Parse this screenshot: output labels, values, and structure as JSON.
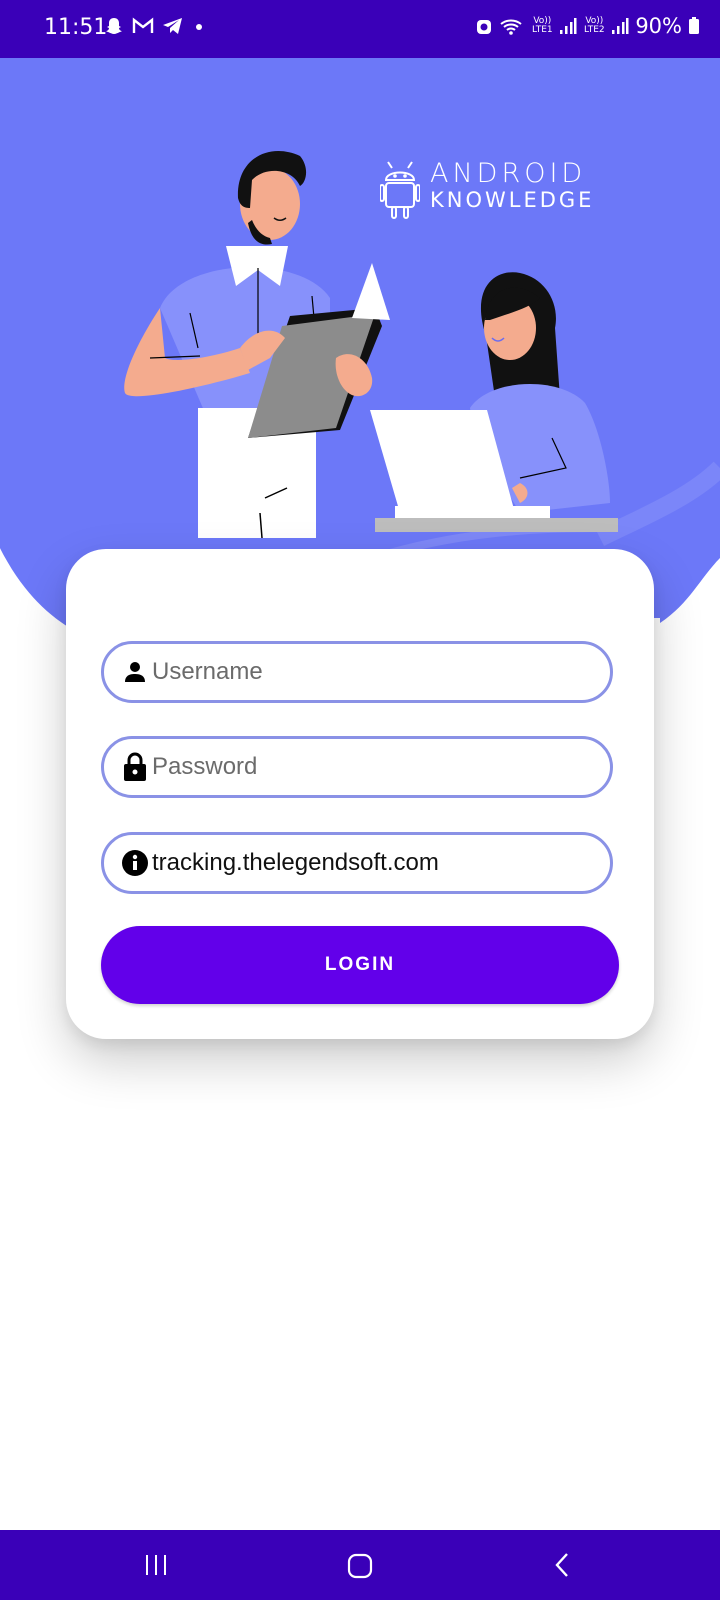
{
  "status_bar": {
    "time": "11:51",
    "battery": "90%",
    "sim1_label": "Vo)) LTE1",
    "sim2_label": "Vo)) LTE2",
    "icons_left": [
      "snapchat-icon",
      "gmail-icon",
      "telegram-icon",
      "dot-icon"
    ],
    "icons_right": [
      "alarm-icon",
      "wifi-icon",
      "signal-icon",
      "signal-icon",
      "battery-icon"
    ]
  },
  "brand": {
    "line1": "ANDROID",
    "line2": "KNOWLEDGE"
  },
  "form": {
    "username_placeholder": "Username",
    "password_placeholder": "Password",
    "server_value": "tracking.thelegendsoft.com",
    "login_label": "LOGIN"
  },
  "colors": {
    "status_bar": "#3a00b8",
    "hero_background": "#6c78f8",
    "field_border": "#8a92e6",
    "login_button": "#6200ea",
    "nav_bar": "#3a00b8"
  },
  "nav_bar": {
    "icons": [
      "recent-apps-icon",
      "home-icon",
      "back-icon"
    ]
  }
}
